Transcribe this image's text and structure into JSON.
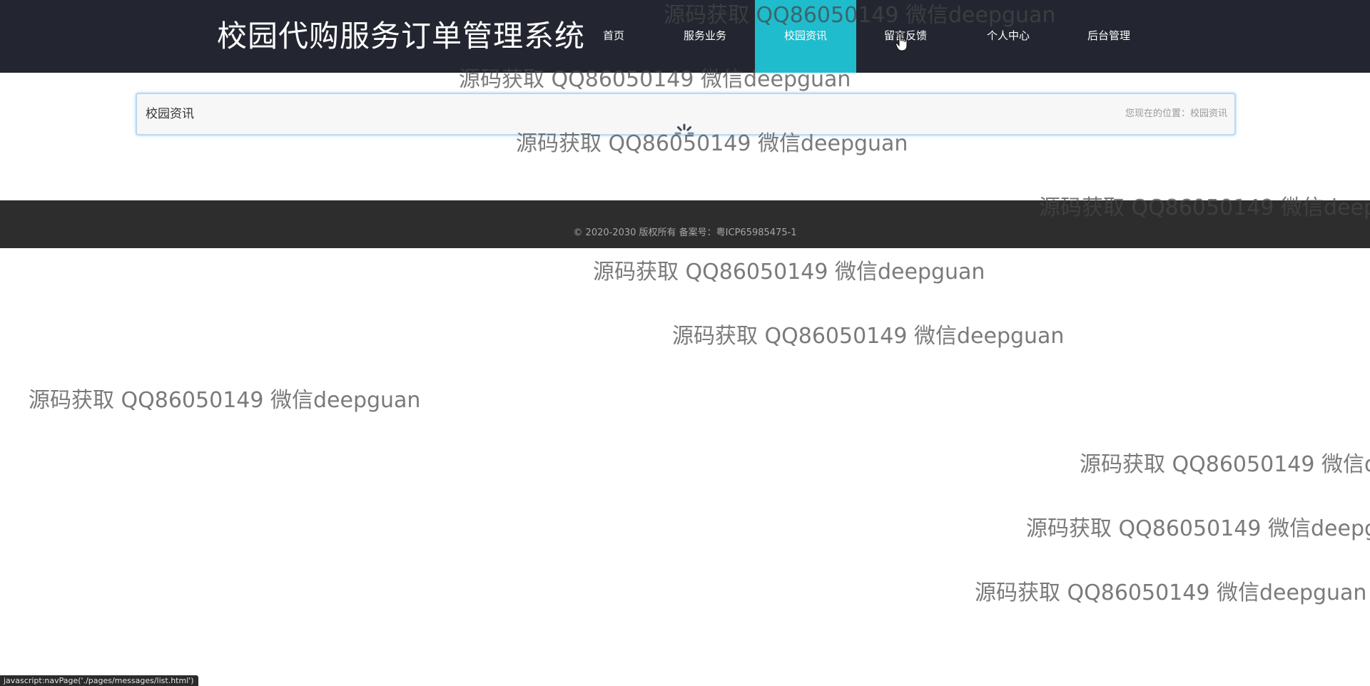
{
  "header": {
    "site_title": "校园代购服务订单管理系统",
    "nav": [
      {
        "label": "首页"
      },
      {
        "label": "服务业务"
      },
      {
        "label": "校园资讯"
      },
      {
        "label": "留言反馈"
      },
      {
        "label": "个人中心"
      },
      {
        "label": "后台管理"
      }
    ],
    "active_nav": "校园资讯"
  },
  "breadcrumb": {
    "title": "校园资讯",
    "location_prefix": "您现在的位置：",
    "location_current": "校园资讯"
  },
  "footer": {
    "copyright": "© 2020-2030 版权所有 备案号：粤ICP65985475-1"
  },
  "status_bar": {
    "url": "javascript:navPage('./pages/messages/list.html')"
  },
  "watermark": {
    "text": "源码获取 QQ86050149 微信deepguan"
  },
  "colors": {
    "header_bg": "#232630",
    "active_nav_bg": "#1fbccd",
    "footer_bg": "#2d2d2d"
  }
}
